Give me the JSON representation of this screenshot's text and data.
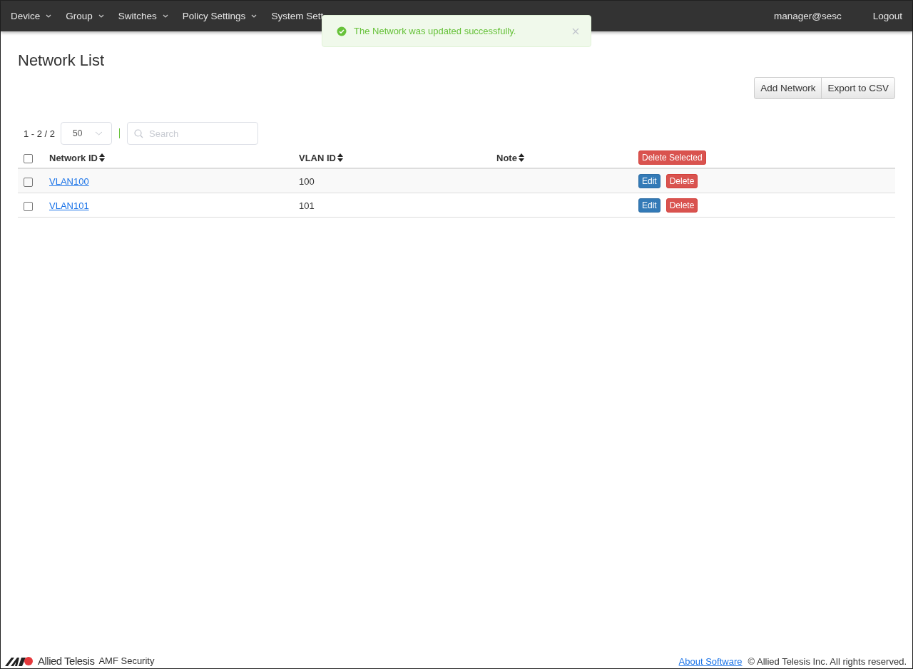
{
  "nav": {
    "menus": [
      {
        "label": "Device",
        "dropdown": true
      },
      {
        "label": "Group",
        "dropdown": true
      },
      {
        "label": "Switches",
        "dropdown": true
      },
      {
        "label": "Policy Settings",
        "dropdown": true
      },
      {
        "label": "System Sett",
        "dropdown": false
      }
    ],
    "user": "manager@sesc",
    "logout": "Logout"
  },
  "toast": {
    "message": "The Network was updated successfully."
  },
  "page": {
    "title": "Network List",
    "actions": [
      "Add Network",
      "Export to CSV"
    ]
  },
  "pager": {
    "range": "1 - 2 / 2",
    "page_size": "50"
  },
  "search": {
    "placeholder": "Search"
  },
  "table": {
    "columns": [
      "Network ID",
      "VLAN ID",
      "Note"
    ],
    "bulk_action": "Delete Selected",
    "all_checked": false,
    "rows": [
      {
        "network_id": "VLAN100",
        "vlan_id": "100",
        "checked": false,
        "edit": "Edit",
        "delete": "Delete"
      },
      {
        "network_id": "VLAN101",
        "vlan_id": "101",
        "checked": false,
        "edit": "Edit",
        "delete": "Delete"
      }
    ]
  },
  "footer": {
    "brand": "Allied Telesis",
    "product": "AMF Security",
    "link": "About Software",
    "copyright": "© Allied Telesis Inc. All rights reserved."
  }
}
